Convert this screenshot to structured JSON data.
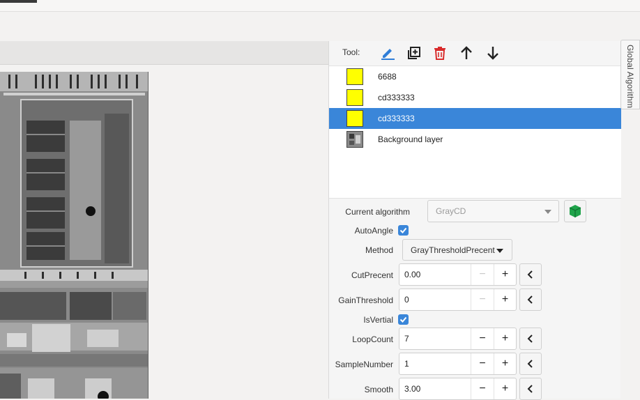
{
  "toolbar": {
    "label": "Tool:",
    "icons": [
      "edit-icon",
      "add-layer-icon",
      "delete-icon",
      "move-up-icon",
      "move-down-icon"
    ],
    "accent": "#2f7ed8",
    "danger": "#d92c2c"
  },
  "layers": [
    {
      "name": "6688",
      "color": "#ffff00",
      "selected": false
    },
    {
      "name": "cd333333",
      "color": "#ffff00",
      "selected": false
    },
    {
      "name": "cd333333",
      "color": "#ffff00",
      "selected": true
    },
    {
      "name": "Background layer",
      "color": "",
      "selected": false
    }
  ],
  "props": {
    "current_algorithm_label": "Current algorithm",
    "current_algorithm_value": "GrayCD",
    "auto_angle_label": "AutoAngle",
    "auto_angle_checked": true,
    "method_label": "Method",
    "method_value": "GrayThresholdPrecent",
    "cut_precent_label": "CutPrecent",
    "cut_precent_value": "0.00",
    "gain_threshold_label": "GainThreshold",
    "gain_threshold_value": "0",
    "is_vertial_label": "IsVertial",
    "is_vertial_checked": true,
    "loop_count_label": "LoopCount",
    "loop_count_value": "7",
    "sample_number_label": "SampleNumber",
    "sample_number_value": "1",
    "smooth_label": "Smooth",
    "smooth_value": "3.00"
  },
  "side_tab": {
    "label": "Global Algorithm"
  },
  "colors": {
    "selection": "#3a86d9",
    "checkbox": "#3a86d9",
    "cube": "#1fa34a"
  }
}
